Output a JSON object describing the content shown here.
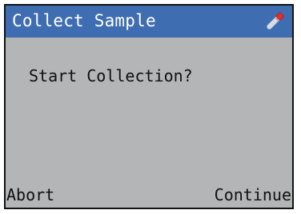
{
  "screen": {
    "title": "Collect Sample",
    "title_icon": "sample-tube-icon",
    "prompt": "Start Collection?",
    "softkeys": {
      "left_label": "Abort",
      "right_label": "Continue"
    }
  },
  "colors": {
    "title_bar": "#3f6db2",
    "screen_background": "#b3b5b6",
    "text": "#101010",
    "title_text": "#ffffff"
  }
}
